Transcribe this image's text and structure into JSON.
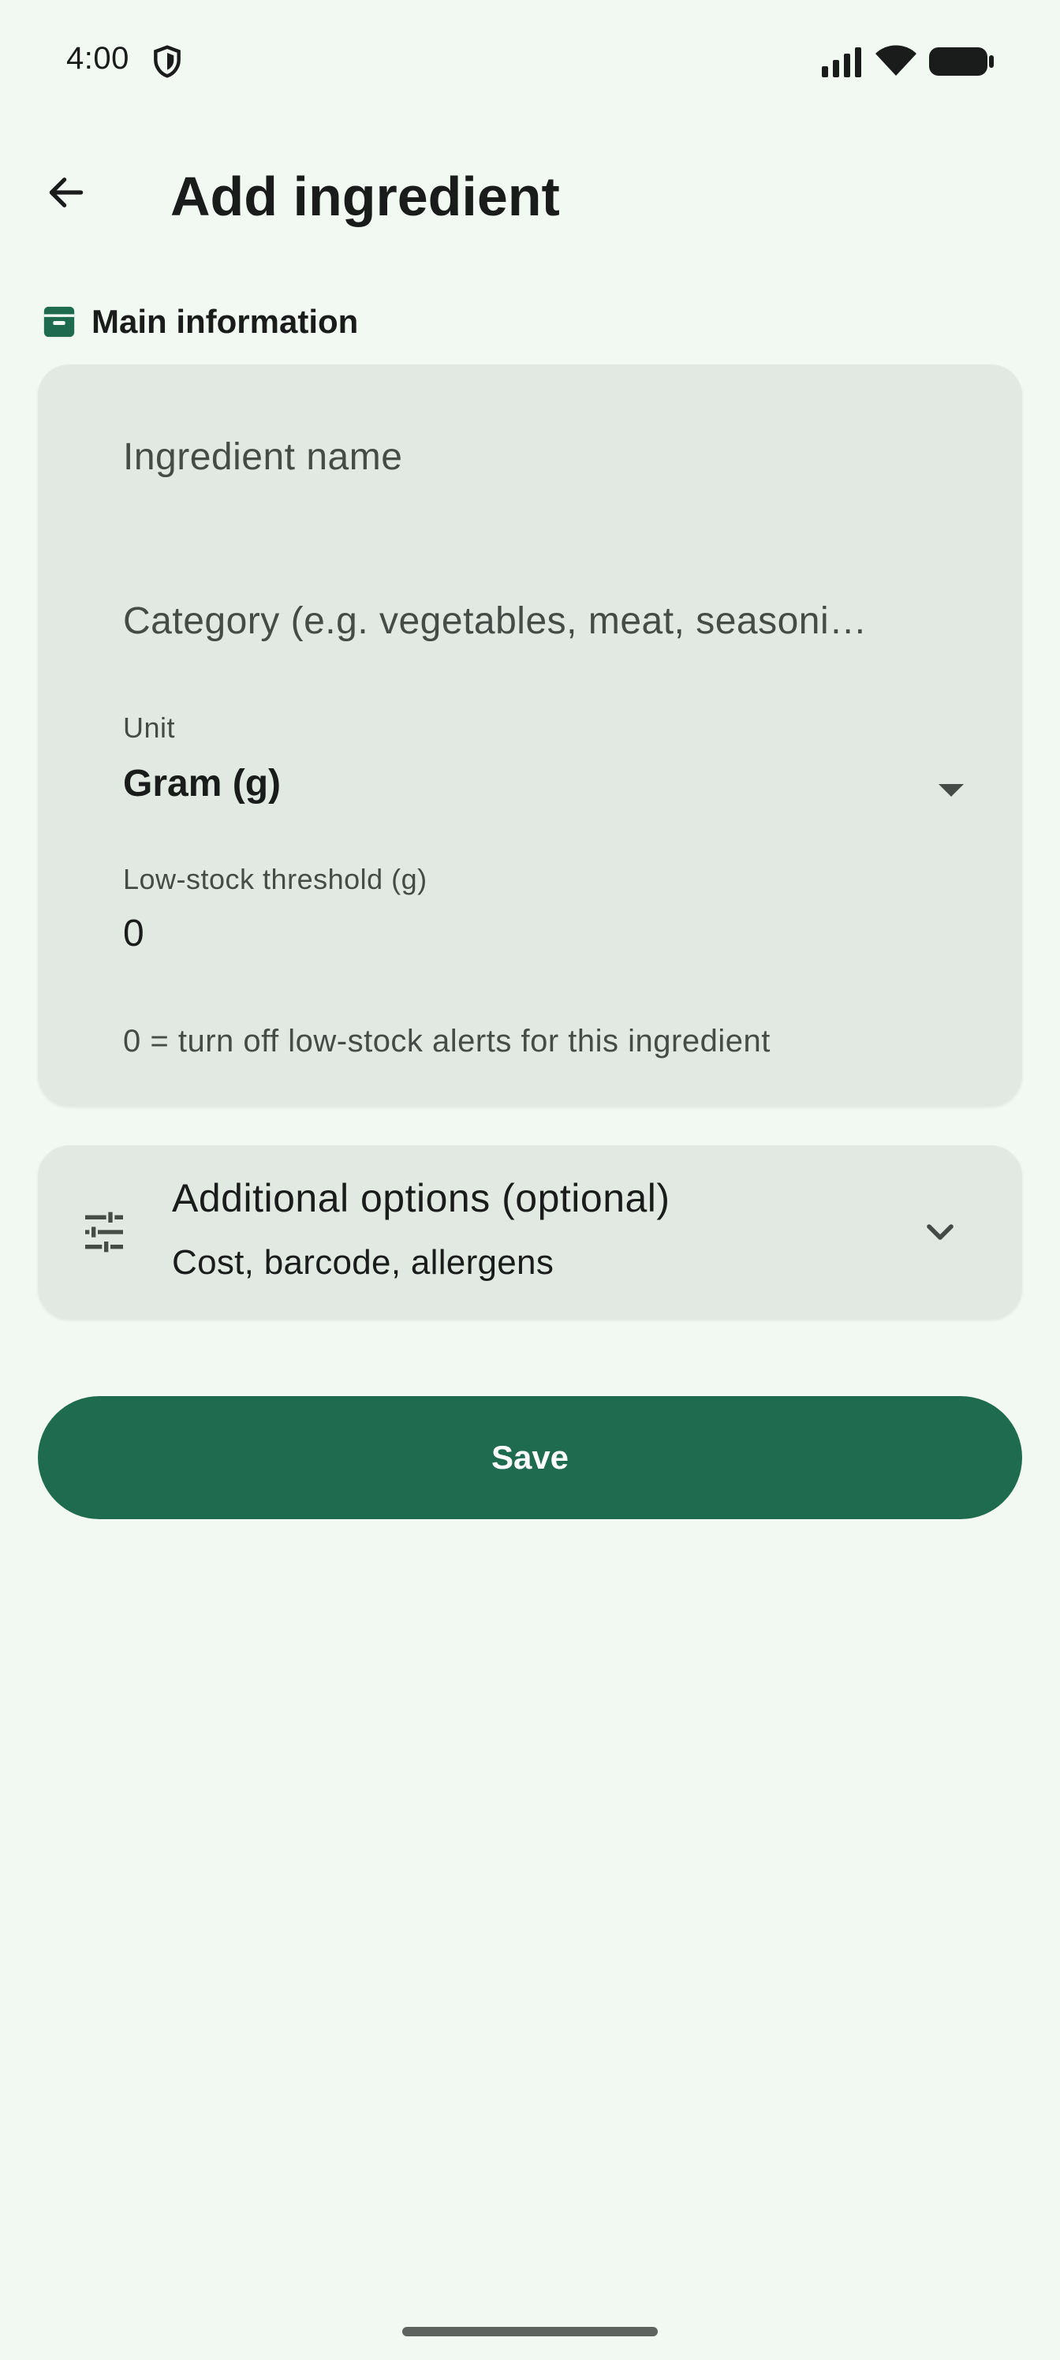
{
  "status_bar": {
    "time": "4:00",
    "icons": [
      "shield-icon",
      "signal-icon",
      "wifi-icon",
      "battery-icon"
    ]
  },
  "app_bar": {
    "back_icon": "arrow-back-icon",
    "title": "Add ingredient"
  },
  "section": {
    "icon": "archive-icon",
    "title": "Main information"
  },
  "form": {
    "name": {
      "placeholder": "Ingredient name",
      "value": ""
    },
    "category": {
      "placeholder": "Category (e.g. vegetables, meat, seasoni…",
      "value": ""
    },
    "unit": {
      "label": "Unit",
      "value": "Gram (g)"
    },
    "threshold": {
      "label": "Low-stock threshold (g)",
      "value": "0"
    },
    "helper": "0 = turn off low-stock alerts for this ingredient"
  },
  "options": {
    "icon": "tune-icon",
    "title": "Additional options (optional)",
    "subtitle": "Cost, barcode, allergens"
  },
  "actions": {
    "save_label": "Save"
  },
  "colors": {
    "background": "#f2f9f3",
    "card": "#e2e9e3",
    "accent": "#1f6b50",
    "text": "#191c1a",
    "muted": "#454b47"
  }
}
